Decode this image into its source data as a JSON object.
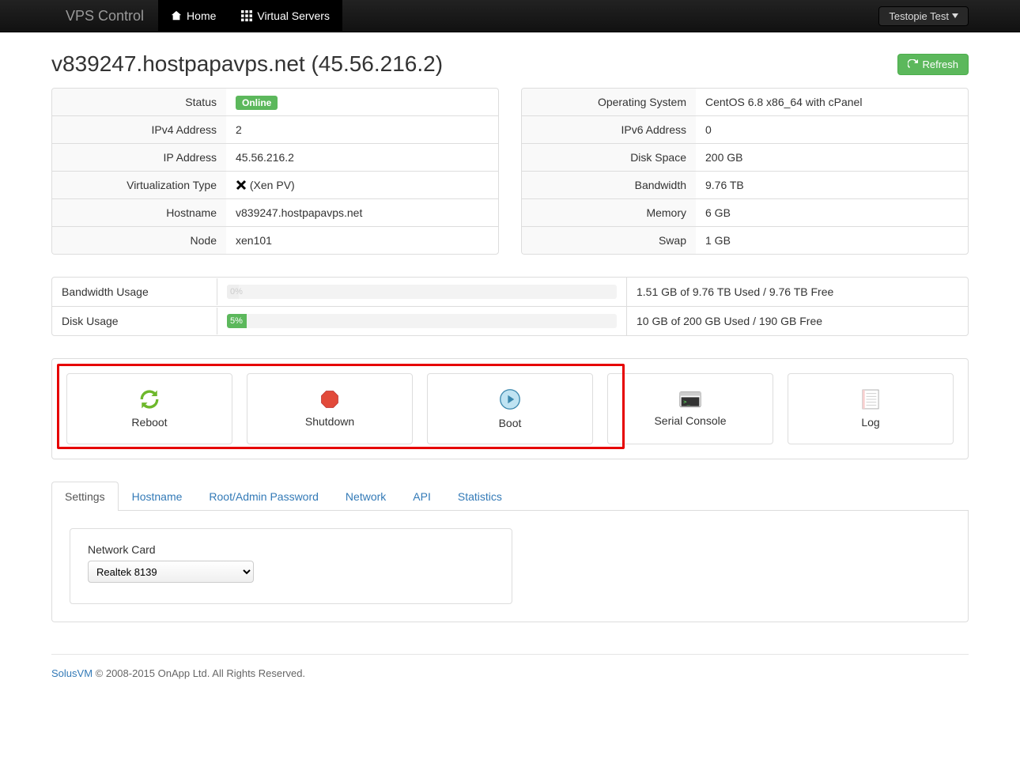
{
  "nav": {
    "brand": "VPS Control",
    "home": "Home",
    "vservers": "Virtual Servers",
    "user": "Testopie Test"
  },
  "header": {
    "title": "v839247.hostpapavps.net (45.56.216.2)",
    "refresh": "Refresh"
  },
  "left": {
    "status": {
      "label": "Status",
      "value": "Online"
    },
    "ipv4": {
      "label": "IPv4 Address",
      "value": "2"
    },
    "ip": {
      "label": "IP Address",
      "value": "45.56.216.2"
    },
    "virt": {
      "label": "Virtualization Type",
      "value": "(Xen PV)"
    },
    "hostname": {
      "label": "Hostname",
      "value": "v839247.hostpapavps.net"
    },
    "node": {
      "label": "Node",
      "value": "xen101"
    }
  },
  "right": {
    "os": {
      "label": "Operating System",
      "value": "CentOS 6.8 x86_64 with cPanel"
    },
    "ipv6": {
      "label": "IPv6 Address",
      "value": "0"
    },
    "disk": {
      "label": "Disk Space",
      "value": "200 GB"
    },
    "bw": {
      "label": "Bandwidth",
      "value": "9.76 TB"
    },
    "mem": {
      "label": "Memory",
      "value": "6 GB"
    },
    "swap": {
      "label": "Swap",
      "value": "1 GB"
    }
  },
  "usage": {
    "bw": {
      "label": "Bandwidth Usage",
      "pct": "0%",
      "text": "1.51 GB of 9.76 TB Used / 9.76 TB Free"
    },
    "disk": {
      "label": "Disk Usage",
      "pct": "5%",
      "text": "10 GB of 200 GB Used / 190 GB Free"
    }
  },
  "actions": {
    "reboot": "Reboot",
    "shutdown": "Shutdown",
    "boot": "Boot",
    "console": "Serial Console",
    "log": "Log"
  },
  "tabs": {
    "settings": "Settings",
    "hostname": "Hostname",
    "password": "Root/Admin Password",
    "network": "Network",
    "api": "API",
    "stats": "Statistics"
  },
  "settings": {
    "nic_label": "Network Card",
    "nic_value": "Realtek 8139"
  },
  "footer": {
    "brand": "SolusVM",
    "copy": " © 2008-2015 OnApp Ltd. All Rights Reserved."
  }
}
